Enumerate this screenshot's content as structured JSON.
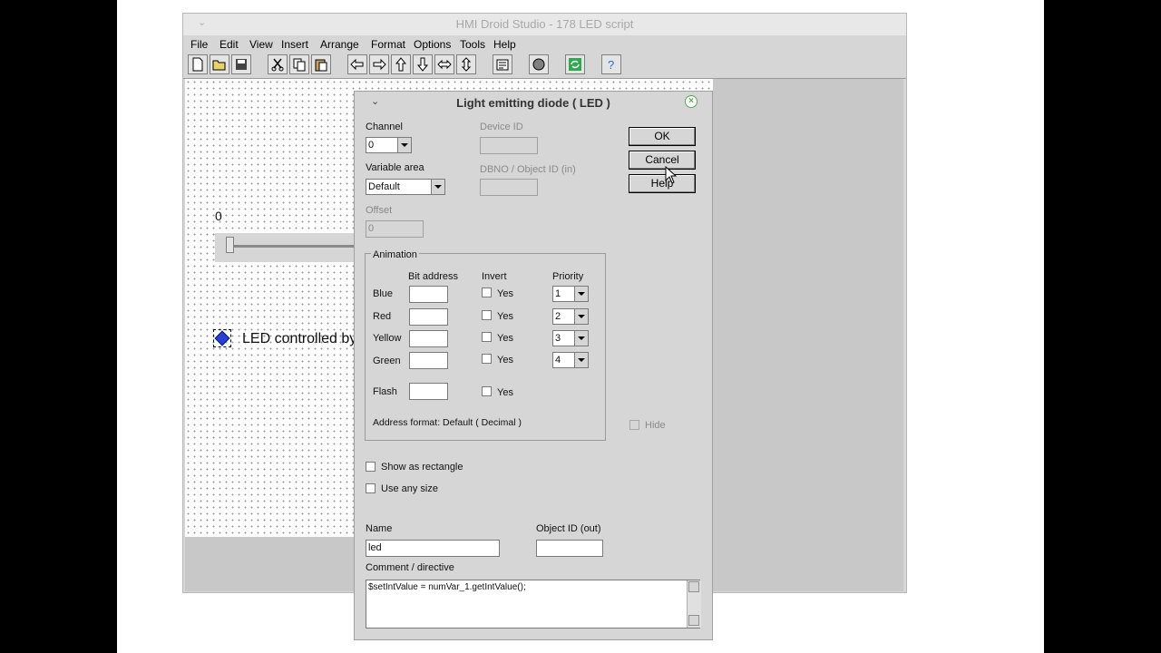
{
  "main_window": {
    "title": "HMI Droid Studio - 178 LED script",
    "menus": [
      "File",
      "Edit",
      "View",
      "Insert",
      "Arrange",
      "Format",
      "Options",
      "Tools",
      "Help"
    ]
  },
  "toolbar_icons": [
    "new-file-icon",
    "open-folder-icon",
    "save-icon",
    "cut-icon",
    "copy-icon",
    "paste-icon",
    "arrow-left-icon",
    "arrow-right-icon",
    "arrow-up-icon",
    "arrow-down-icon",
    "arrow-left-right-icon",
    "arrow-up-down-icon",
    "properties-icon",
    "record-icon",
    "refresh-icon",
    "help-icon"
  ],
  "canvas": {
    "slider_value": "0",
    "led_label": "LED controlled by"
  },
  "dialog": {
    "title": "Light emitting diode ( LED )",
    "channel_label": "Channel",
    "channel_value": "0",
    "variable_area_label": "Variable area",
    "variable_area_value": "Default",
    "offset_label": "Offset",
    "offset_value": "0",
    "device_id_label": "Device ID",
    "device_id_value": "",
    "dbno_label": "DBNO / Object ID (in)",
    "dbno_value": "",
    "ok": "OK",
    "cancel": "Cancel",
    "help": "Help",
    "animation": {
      "group_label": "Animation",
      "col_bit_address": "Bit address",
      "col_invert": "Invert",
      "col_priority": "Priority",
      "rows": [
        {
          "name": "Blue",
          "bit": "",
          "invert": "Yes",
          "priority": "1"
        },
        {
          "name": "Red",
          "bit": "",
          "invert": "Yes",
          "priority": "2"
        },
        {
          "name": "Yellow",
          "bit": "",
          "invert": "Yes",
          "priority": "3"
        },
        {
          "name": "Green",
          "bit": "",
          "invert": "Yes",
          "priority": "4"
        }
      ],
      "flash_label": "Flash",
      "flash_invert": "Yes",
      "address_format": "Address format: Default ( Decimal )"
    },
    "hide_label": "Hide",
    "show_as_rectangle": "Show as rectangle",
    "use_any_size": "Use any size",
    "name_label": "Name",
    "name_value": "led",
    "object_id_out_label": "Object ID (out)",
    "object_id_out_value": "",
    "comment_label": "Comment / directive",
    "comment_value": "$setIntValue = numVar_1.getIntValue();"
  }
}
